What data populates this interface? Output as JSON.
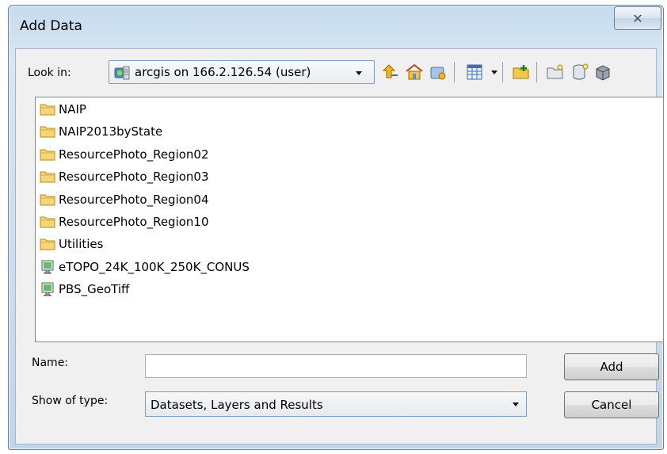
{
  "window": {
    "title": "Add Data",
    "close_glyph": "✕"
  },
  "lookin": {
    "label": "Look in:",
    "value": "arcgis on 166.2.126.54 (user)",
    "icon": "server-connection-icon"
  },
  "toolbar": {
    "buttons": [
      {
        "name": "up-one-level-icon"
      },
      {
        "name": "home-icon"
      },
      {
        "name": "go-to-folder-icon"
      },
      {
        "name": "view-options-icon"
      },
      {
        "name": "connect-to-folder-icon"
      },
      {
        "name": "new-folder-icon"
      },
      {
        "name": "new-database-icon"
      },
      {
        "name": "new-server-icon"
      }
    ]
  },
  "file_list": {
    "items": [
      {
        "label": "NAIP",
        "icon": "folder-icon"
      },
      {
        "label": "NAIP2013byState",
        "icon": "folder-icon"
      },
      {
        "label": "ResourcePhoto_Region02",
        "icon": "folder-icon"
      },
      {
        "label": "ResourcePhoto_Region03",
        "icon": "folder-icon"
      },
      {
        "label": "ResourcePhoto_Region04",
        "icon": "folder-icon"
      },
      {
        "label": "ResourcePhoto_Region10",
        "icon": "folder-icon"
      },
      {
        "label": "Utilities",
        "icon": "folder-icon"
      },
      {
        "label": "eTOPO_24K_100K_250K_CONUS",
        "icon": "image-service-icon"
      },
      {
        "label": "PBS_GeoTiff",
        "icon": "image-service-icon"
      }
    ]
  },
  "name_field": {
    "label": "Name:",
    "value": ""
  },
  "type_field": {
    "label": "Show of type:",
    "value": "Datasets, Layers and Results"
  },
  "buttons": {
    "add": "Add",
    "cancel": "Cancel"
  }
}
